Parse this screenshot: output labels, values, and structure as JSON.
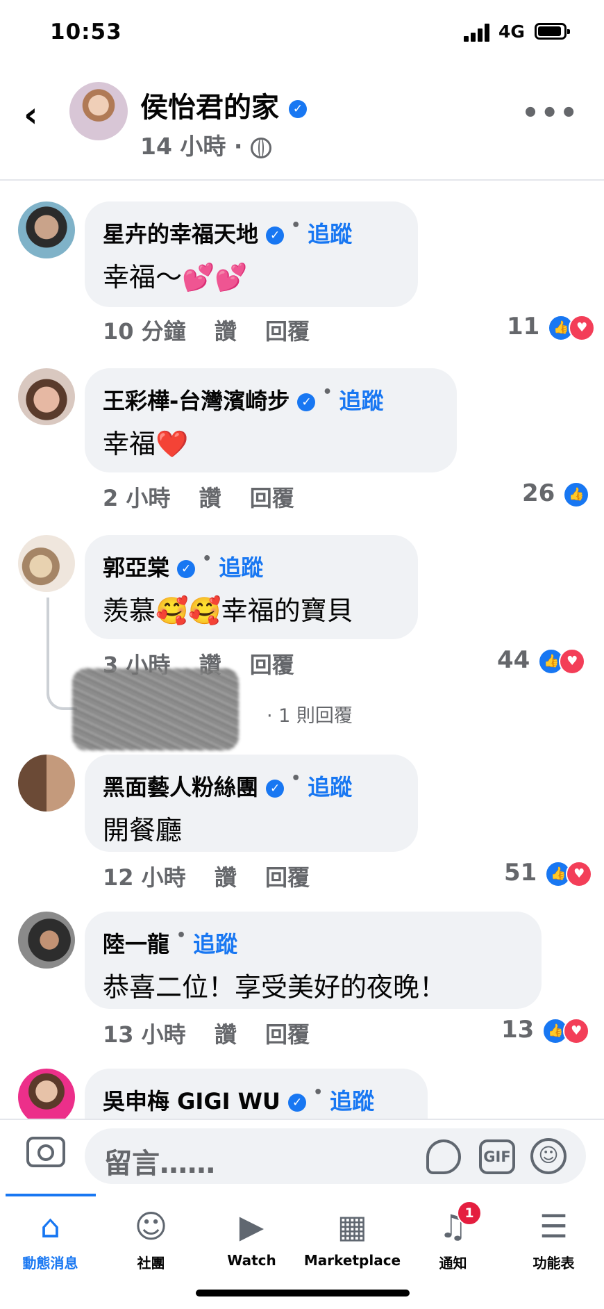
{
  "status": {
    "time": "10:53",
    "network": "4G"
  },
  "header": {
    "page_name": "侯怡君的家",
    "time_ago": "14 小時",
    "separator": "·"
  },
  "comments": [
    {
      "name": "星卉的幸福天地",
      "follow": "追蹤",
      "text": "幸福～💕💕",
      "time": "10 分鐘",
      "like": "讚",
      "reply": "回覆",
      "count": "11"
    },
    {
      "name": "王彩樺-台灣濱崎步",
      "follow": "追蹤",
      "text": "幸福❤️",
      "time": "2 小時",
      "like": "讚",
      "reply": "回覆",
      "count": "26"
    },
    {
      "name": "郭亞棠",
      "follow": "追蹤",
      "text": "羨慕🥰🥰幸福的寶貝",
      "time": "3 小時",
      "like": "讚",
      "reply": "回覆",
      "count": "44",
      "reply_count": "· 1 則回覆"
    },
    {
      "name": "黑面藝人粉絲團",
      "follow": "追蹤",
      "text": "開餐廳",
      "time": "12 小時",
      "like": "讚",
      "reply": "回覆",
      "count": "51"
    },
    {
      "name": "陸一龍",
      "follow": "追蹤",
      "text": "恭喜二位！享受美好的夜晚！",
      "time": "13 小時",
      "like": "讚",
      "reply": "回覆",
      "count": "13"
    },
    {
      "name": "吳申梅 GIGI WU",
      "follow": "追蹤"
    }
  ],
  "input": {
    "placeholder": "留言……",
    "gif": "GIF"
  },
  "tabs": [
    {
      "label": "動態消息",
      "icon": "home-icon"
    },
    {
      "label": "社團",
      "icon": "groups-icon"
    },
    {
      "label": "Watch",
      "icon": "watch-icon"
    },
    {
      "label": "Marketplace",
      "icon": "marketplace-icon"
    },
    {
      "label": "通知",
      "icon": "bell-icon",
      "badge": "1"
    },
    {
      "label": "功能表",
      "icon": "menu-icon"
    }
  ],
  "colors": {
    "accent": "#1877f2",
    "love": "#f33e58",
    "bubble": "#f0f2f5"
  }
}
